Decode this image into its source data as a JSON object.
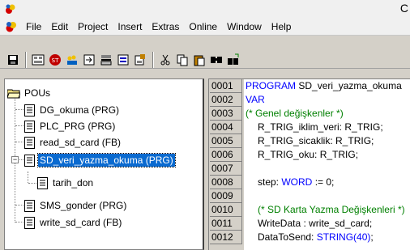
{
  "title_bar": {
    "title_fragment": "C"
  },
  "menu": {
    "items": [
      "File",
      "Edit",
      "Project",
      "Insert",
      "Extras",
      "Online",
      "Window",
      "Help"
    ]
  },
  "toolbar": {
    "buttons": [
      "save-icon",
      "build-icon",
      "stop-icon",
      "login-icon",
      "step-icon",
      "cycle-icon",
      "watch-icon",
      "write-icon",
      "cut-icon",
      "copy-icon",
      "paste-icon",
      "find-icon",
      "replace-icon"
    ]
  },
  "tree": {
    "root": "POUs",
    "items": [
      {
        "label": "DG_okuma (PRG)"
      },
      {
        "label": "PLC_PRG (PRG)"
      },
      {
        "label": "read_sd_card (FB)"
      },
      {
        "label": "SD_veri_yazma_okuma (PRG)",
        "selected": true,
        "expanded": true,
        "children": [
          "tarih_don"
        ]
      },
      {
        "label": "SMS_gonder (PRG)"
      },
      {
        "label": "write_sd_card (FB)"
      }
    ]
  },
  "code": {
    "line_numbers": [
      "0001",
      "0002",
      "0003",
      "0004",
      "0005",
      "0006",
      "0007",
      "0008",
      "0009",
      "0010",
      "0011",
      "0012"
    ],
    "lines": [
      {
        "kw": "PROGRAM",
        "text": " SD_veri_yazma_okuma"
      },
      {
        "kw": "VAR",
        "text": ""
      },
      {
        "comment": "(* Genel değişkenler *)"
      },
      {
        "text": "R_TRIG_iklim_veri: R_TRIG;"
      },
      {
        "text": "R_TRIG_sicaklik: R_TRIG;"
      },
      {
        "text": "R_TRIG_oku: R_TRIG;"
      },
      {
        "text": ""
      },
      {
        "text": "step: ",
        "kw2": "WORD",
        "text2": " := 0;"
      },
      {
        "text": ""
      },
      {
        "comment": "(* SD Karta Yazma Değişkenleri *)"
      },
      {
        "text": "WriteData : write_sd_card;"
      },
      {
        "text": "DataToSend: ",
        "kw2": "STRING(40)",
        "text2": ";"
      }
    ]
  }
}
